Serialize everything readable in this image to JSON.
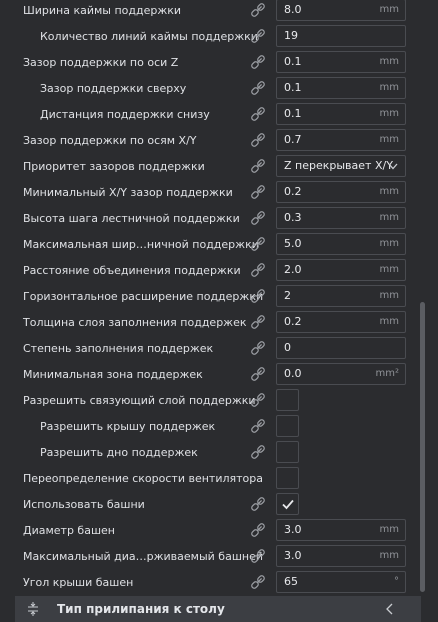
{
  "settings": [
    {
      "label": "Ширина каймы поддержки",
      "indent": 0,
      "kind": "text",
      "value": "8.0",
      "unit": "mm",
      "linked": true
    },
    {
      "label": "Количество линий каймы поддержки",
      "indent": 1,
      "kind": "text",
      "value": "19",
      "unit": "",
      "linked": true
    },
    {
      "label": "Зазор поддержки по оси Z",
      "indent": 0,
      "kind": "text",
      "value": "0.1",
      "unit": "mm",
      "linked": true
    },
    {
      "label": "Зазор поддержки сверху",
      "indent": 1,
      "kind": "text",
      "value": "0.1",
      "unit": "mm",
      "linked": true
    },
    {
      "label": "Дистанция поддержки снизу",
      "indent": 1,
      "kind": "text",
      "value": "0.1",
      "unit": "mm",
      "linked": true
    },
    {
      "label": "Зазор поддержки по осям X/Y",
      "indent": 0,
      "kind": "text",
      "value": "0.7",
      "unit": "mm",
      "linked": true
    },
    {
      "label": "Приоритет зазоров поддержки",
      "indent": 0,
      "kind": "select",
      "value": "Z перекрывает X/Y",
      "unit": "",
      "linked": true
    },
    {
      "label": "Минимальный X/Y зазор поддержки",
      "indent": 0,
      "kind": "text",
      "value": "0.2",
      "unit": "mm",
      "linked": true
    },
    {
      "label": "Высота шага лестничной поддержки",
      "indent": 0,
      "kind": "text",
      "value": "0.3",
      "unit": "mm",
      "linked": true
    },
    {
      "label": "Максимальная шир…ничной поддержки",
      "indent": 0,
      "kind": "text",
      "value": "5.0",
      "unit": "mm",
      "linked": true
    },
    {
      "label": "Расстояние объединения поддержки",
      "indent": 0,
      "kind": "text",
      "value": "2.0",
      "unit": "mm",
      "linked": true
    },
    {
      "label": "Горизонтальное расширение поддержки",
      "indent": 0,
      "kind": "text",
      "value": "2",
      "unit": "mm",
      "linked": true
    },
    {
      "label": "Толщина слоя заполнения поддержек",
      "indent": 0,
      "kind": "text",
      "value": "0.2",
      "unit": "mm",
      "linked": true
    },
    {
      "label": "Степень заполнения поддержек",
      "indent": 0,
      "kind": "text",
      "value": "0",
      "unit": "",
      "linked": true
    },
    {
      "label": "Минимальная зона поддержек",
      "indent": 0,
      "kind": "text",
      "value": "0.0",
      "unit": "mm²",
      "linked": true
    },
    {
      "label": "Разрешить связующий слой поддержки",
      "indent": 0,
      "kind": "check",
      "checked": false,
      "linked": true
    },
    {
      "label": "Разрешить крышу поддержек",
      "indent": 1,
      "kind": "check",
      "checked": false,
      "linked": true
    },
    {
      "label": "Разрешить дно поддержек",
      "indent": 1,
      "kind": "check",
      "checked": false,
      "linked": true
    },
    {
      "label": "Переопределение скорости вентилятора",
      "indent": 0,
      "kind": "check",
      "checked": false,
      "linked": false
    },
    {
      "label": "Использовать башни",
      "indent": 0,
      "kind": "check",
      "checked": true,
      "linked": true
    },
    {
      "label": "Диаметр башен",
      "indent": 0,
      "kind": "text",
      "value": "3.0",
      "unit": "mm",
      "linked": true
    },
    {
      "label": "Максимальный диа…рживаемый башней",
      "indent": 0,
      "kind": "text",
      "value": "3.0",
      "unit": "mm",
      "linked": true
    },
    {
      "label": "Угол крыши башен",
      "indent": 0,
      "kind": "text",
      "value": "65",
      "unit": "°",
      "linked": true
    }
  ],
  "section": {
    "title": "Тип прилипания к столу",
    "icon": "adhesion-icon",
    "chevron": "chevron-left-icon"
  },
  "colors": {
    "background": "#2b2c2f",
    "field_border": "#4a4c51",
    "section_bg": "#3c3e43",
    "text": "#dfe1e5",
    "unit_text": "#8f9297"
  }
}
